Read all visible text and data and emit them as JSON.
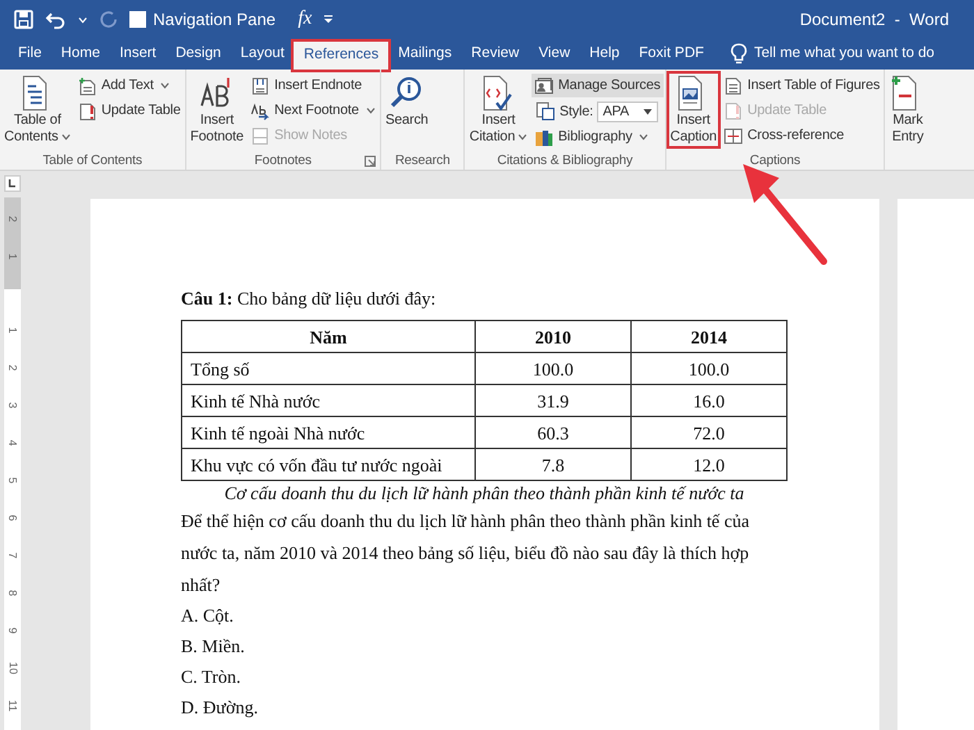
{
  "quick_access": {
    "checkbox_label": "Navigation Pane",
    "checked": false,
    "formula": "fx"
  },
  "window": {
    "title": "Document2  -  Word"
  },
  "tabs": [
    {
      "label": "File",
      "selected": false,
      "highlighted": false
    },
    {
      "label": "Home",
      "selected": false,
      "highlighted": false
    },
    {
      "label": "Insert",
      "selected": false,
      "highlighted": false
    },
    {
      "label": "Design",
      "selected": false,
      "highlighted": false
    },
    {
      "label": "Layout",
      "selected": false,
      "highlighted": false
    },
    {
      "label": "References",
      "selected": true,
      "highlighted": true
    },
    {
      "label": "Mailings",
      "selected": false,
      "highlighted": false
    },
    {
      "label": "Review",
      "selected": false,
      "highlighted": false
    },
    {
      "label": "View",
      "selected": false,
      "highlighted": false
    },
    {
      "label": "Help",
      "selected": false,
      "highlighted": false
    },
    {
      "label": "Foxit PDF",
      "selected": false,
      "highlighted": false
    }
  ],
  "tell_me": "Tell me what you want to do",
  "ribbon": {
    "groups": [
      {
        "label": "Table of Contents",
        "launcher": false,
        "items": [
          {
            "kind": "large",
            "label": "Table of\nContents",
            "dropdown": true,
            "highlighted": false
          },
          {
            "kind": "small",
            "label": "Add Text",
            "dropdown": true,
            "disabled": false,
            "active": false
          },
          {
            "kind": "small",
            "label": "Update Table",
            "dropdown": false,
            "disabled": false,
            "active": false
          }
        ]
      },
      {
        "label": "Footnotes",
        "launcher": true,
        "items": [
          {
            "kind": "large",
            "label": "Insert\nFootnote",
            "dropdown": false,
            "highlighted": false
          },
          {
            "kind": "small",
            "label": "Insert Endnote",
            "dropdown": false,
            "disabled": false,
            "active": false
          },
          {
            "kind": "small",
            "label": "Next Footnote",
            "dropdown": true,
            "disabled": false,
            "active": false
          },
          {
            "kind": "small",
            "label": "Show Notes",
            "dropdown": false,
            "disabled": true,
            "active": false
          }
        ]
      },
      {
        "label": "Research",
        "launcher": false,
        "items": [
          {
            "kind": "large",
            "label": "Search",
            "dropdown": false,
            "highlighted": false
          }
        ]
      },
      {
        "label": "Citations & Bibliography",
        "launcher": false,
        "items": [
          {
            "kind": "large",
            "label": "Insert\nCitation",
            "dropdown": true,
            "highlighted": false
          },
          {
            "kind": "small",
            "label": "Manage Sources",
            "dropdown": false,
            "disabled": false,
            "active": true
          },
          {
            "kind": "combo",
            "label": "Style:",
            "value": "APA"
          },
          {
            "kind": "small",
            "label": "Bibliography",
            "dropdown": true,
            "disabled": false,
            "active": false
          }
        ]
      },
      {
        "label": "Captions",
        "launcher": false,
        "items": [
          {
            "kind": "large",
            "label": "Insert\nCaption",
            "dropdown": false,
            "highlighted": true
          },
          {
            "kind": "small",
            "label": "Insert Table of Figures",
            "dropdown": false,
            "disabled": false,
            "active": false
          },
          {
            "kind": "small",
            "label": "Update Table",
            "dropdown": false,
            "disabled": true,
            "active": false
          },
          {
            "kind": "small",
            "label": "Cross-reference",
            "dropdown": false,
            "disabled": false,
            "active": false
          }
        ]
      },
      {
        "launcher": false,
        "items": [
          {
            "kind": "large",
            "label": "Mark\nEntry",
            "dropdown": false,
            "highlighted": false
          }
        ]
      }
    ]
  },
  "ruler": [
    "2",
    "1",
    "1",
    "2",
    "3",
    "4",
    "5",
    "6",
    "7",
    "8",
    "9",
    "10",
    "11"
  ],
  "document": {
    "question": "**Câu 1:** Cho bảng dữ liệu dưới đây:",
    "table": {
      "columns": [
        "Năm",
        "2010",
        "2014"
      ],
      "rows": [
        [
          "Tổng số",
          "100.0",
          "100.0"
        ],
        [
          "Kinh tế Nhà nước",
          "31.9",
          "16.0"
        ],
        [
          "Kinh tế ngoài Nhà nước",
          "60.3",
          "72.0"
        ],
        [
          "Khu vực có vốn đầu tư nước ngoài",
          "7.8",
          "12.0"
        ]
      ]
    },
    "caption": "Cơ cấu doanh thu du lịch lữ hành phân theo thành phần kinh tế nước ta",
    "paragraph": "Để thể hiện cơ cấu doanh thu du lịch lữ hành phân theo thành phần kinh tế của nước ta, năm 2010 và 2014 theo bảng số liệu, biểu đồ nào sau đây là thích hợp nhất?",
    "options": [
      "A. Cột.",
      "B. Miền.",
      "C. Tròn.",
      "D. Đường."
    ]
  }
}
